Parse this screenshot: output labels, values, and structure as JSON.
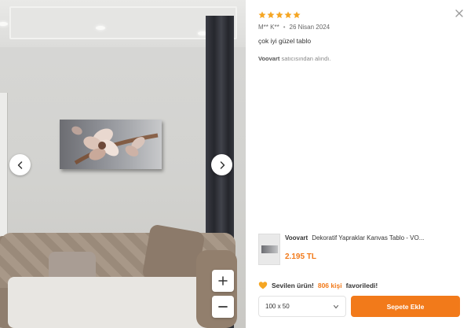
{
  "review": {
    "rating": 5,
    "author": "M** K**",
    "date": "26 Nisan 2024",
    "comment": "çok iyi güzel tablo",
    "seller_name": "Voovart",
    "seller_suffix": "satıcısından alındı."
  },
  "viewer": {
    "prev_icon": "chevron-left-icon",
    "next_icon": "chevron-right-icon",
    "zoom_in_icon": "plus-icon",
    "zoom_out_icon": "minus-icon"
  },
  "product": {
    "brand": "Voovart",
    "name": "Dekoratif Yapraklar Kanvas Tablo - VO...",
    "price": "2.195 TL"
  },
  "favorites": {
    "prefix": "Sevilen ürün!",
    "count": "806 kişi",
    "suffix": "favoriledi!"
  },
  "size_select": {
    "value": "100 x 50"
  },
  "cart_button": {
    "label": "Sepete Ekle"
  },
  "colors": {
    "accent": "#f27a1a",
    "star": "#f5a623"
  }
}
